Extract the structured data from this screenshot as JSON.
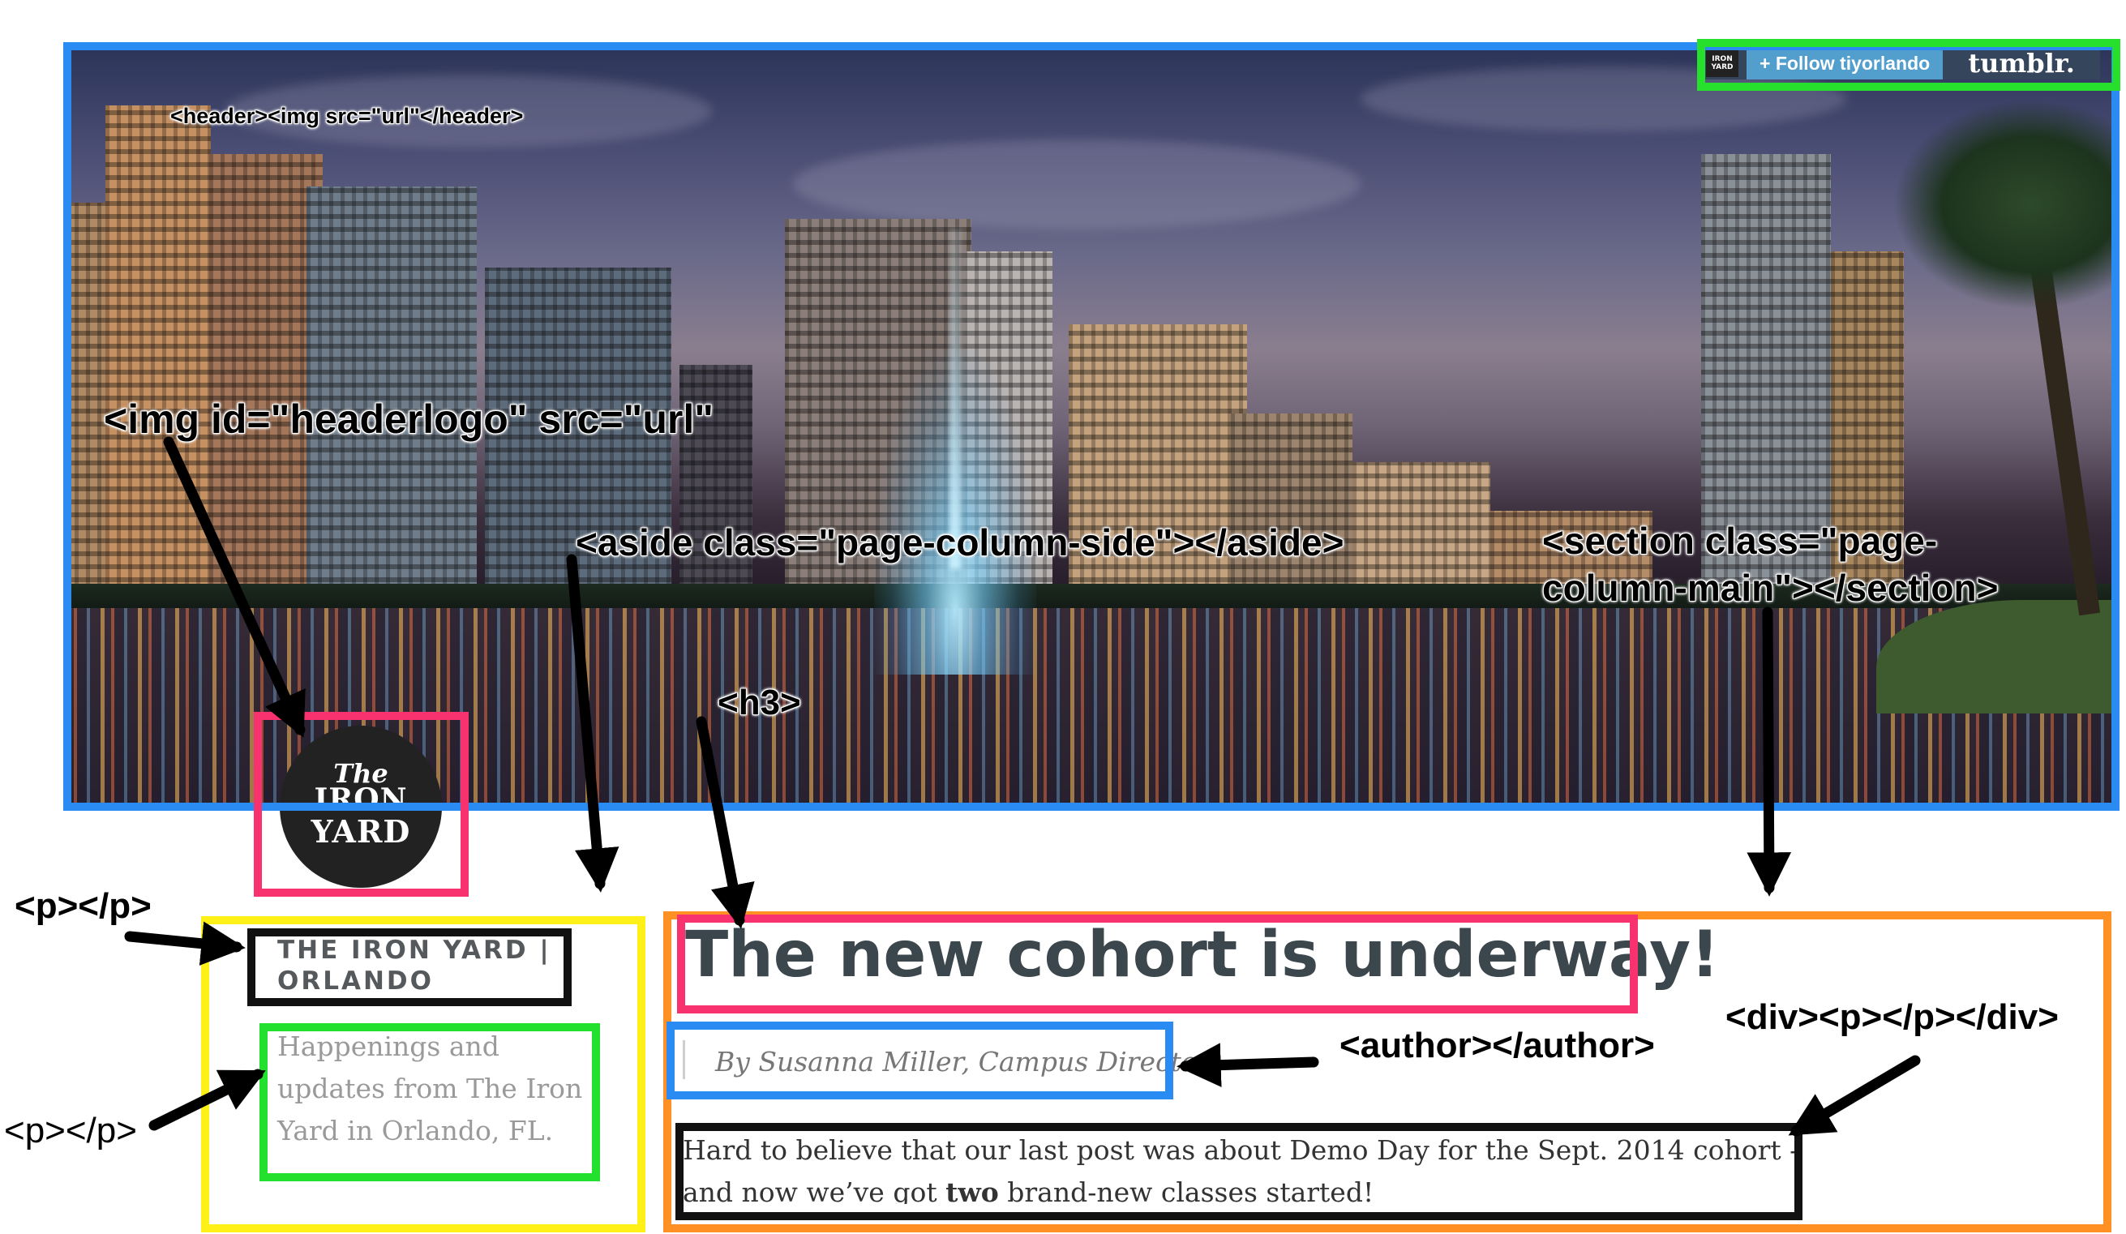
{
  "tumblr": {
    "avatar_text": "IRON YARD",
    "follow_label": "+ Follow tiyorlando",
    "logo_text": "tumblr."
  },
  "logo": {
    "line1": "The",
    "line2": "IRON",
    "line3": "YARD"
  },
  "page": {
    "site_name": "THE IRON YARD | ORLANDO",
    "site_description": "Happenings and updates from The Iron Yard in Orlando, FL.",
    "post_title": "The new cohort is underway!",
    "post_author": "By Susanna Miller, Campus Director",
    "post_body_before": "Hard to believe that our last post was about Demo Day for the Sept. 2014 cohort - and now we’ve got ",
    "post_body_bold": "two",
    "post_body_after": " brand-new classes started!"
  },
  "annotations": {
    "header": "<header><img src=\"url\"</header>",
    "headerlogo": "<img id=\"headerlogo\" src=\"url\"",
    "aside": "<aside class=\"page-column-side\"></aside>",
    "section_line1": "<section class=\"page-",
    "section_line2": "column-main\"></section>",
    "h3": "<h3>",
    "p_top": "<p></p>",
    "p_left": "<p></p>",
    "author": "<author></author>",
    "div": "<div><p></p></div>"
  },
  "colors": {
    "blue_box": "#2a8cf3",
    "green_box": "#27e02e",
    "pink_box": "#f7326e",
    "yellow_box": "#fff018",
    "orange_box": "#ff9024",
    "black_box": "#111111"
  }
}
